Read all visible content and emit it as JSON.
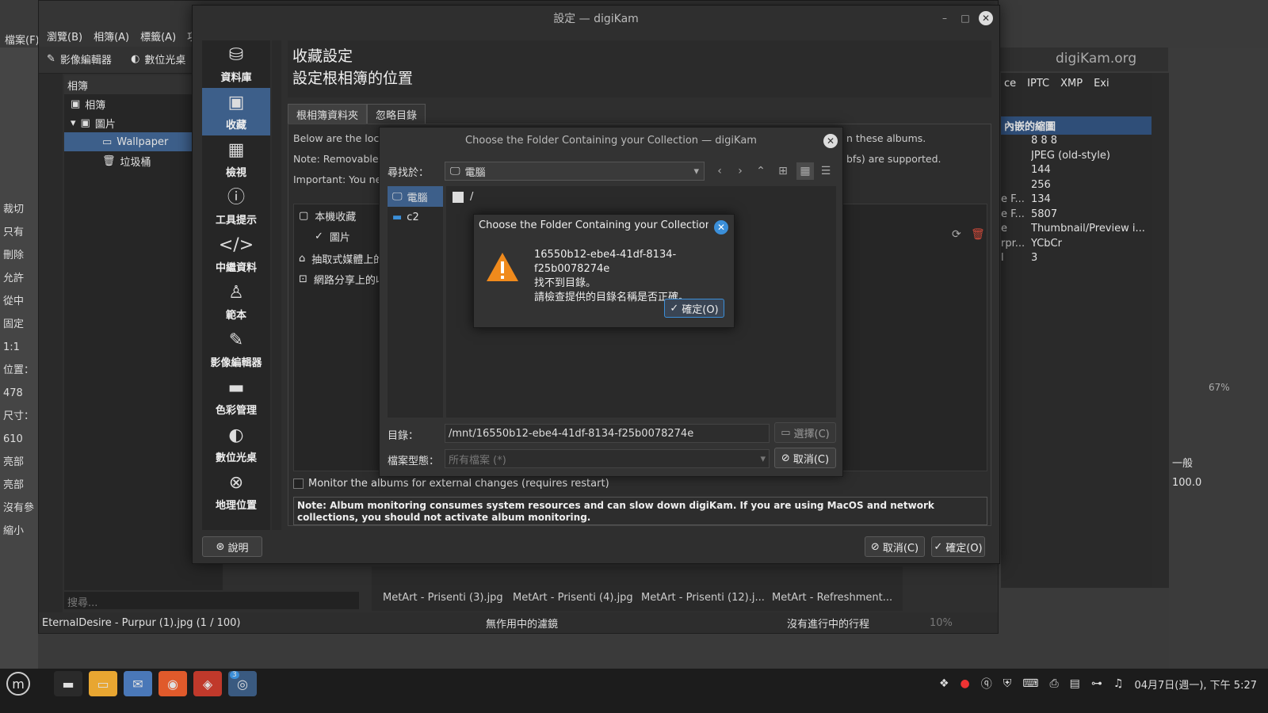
{
  "background": {
    "gimp_left_labels": [
      "檔案(F)",
      "裁切",
      "只有",
      "刪除",
      "允許",
      "從中",
      "固定",
      "1:1",
      "位置：",
      "478",
      "尺寸：",
      "610",
      "亮部",
      "亮部",
      "沒有參",
      "縮小"
    ],
    "digikam_menu": [
      "瀏覽(B)",
      "相簿(A)",
      "標籤(A)",
      "項"
    ],
    "digikam_toolbar": {
      "image_editor": "影像編輯器",
      "light_table": "數位光桌"
    },
    "album_tree": {
      "header": "相簿",
      "root": "相簿",
      "pictures": "圖片",
      "wallpaper": "Wallpaper",
      "trash": "垃圾桶",
      "search_placeholder": "搜尋..."
    },
    "statusbar": {
      "file": "EternalDesire - Purpur (1).jpg  (1 / 100)",
      "filter": "無作用中的濾鏡",
      "process": "沒有進行中的行程",
      "zoom": "10%"
    },
    "thumbnails": [
      "MetArt - Prisenti (3).jpg",
      "MetArt - Prisenti (4).jpg",
      "MetArt - Prisenti (12).j...",
      "MetArt - Refreshment..."
    ],
    "right_panel": {
      "brand": "digiKam.org",
      "tabs": [
        "ce",
        "IPTC",
        "XMP",
        "Exi"
      ],
      "header": "內嵌的縮圖",
      "rows": [
        {
          "key": "",
          "value": "8 8 8"
        },
        {
          "key": "",
          "value": "JPEG (old-style)"
        },
        {
          "key": "",
          "value": "144"
        },
        {
          "key": "",
          "value": "256"
        },
        {
          "key": "e F...",
          "value": "134"
        },
        {
          "key": "e F...",
          "value": "5807"
        },
        {
          "key": "e",
          "value": "Thumbnail/Preview i..."
        },
        {
          "key": "rpr...",
          "value": "YCbCr"
        },
        {
          "key": "l",
          "value": "3"
        }
      ]
    },
    "gimp_right": {
      "zoom": "67%",
      "mode": "一般",
      "opacity": "100.0"
    }
  },
  "settings": {
    "title": "設定 — digiKam",
    "nav": [
      {
        "icon": "database-icon",
        "glyph": "⛁",
        "label": "資料庫"
      },
      {
        "icon": "collection-icon",
        "glyph": "▣",
        "label": "收藏"
      },
      {
        "icon": "grid-view-icon",
        "glyph": "▦",
        "label": "檢視"
      },
      {
        "icon": "info-icon",
        "glyph": "ⓘ",
        "label": "工具提示"
      },
      {
        "icon": "code-icon",
        "glyph": "</>",
        "label": "中繼資料"
      },
      {
        "icon": "person-icon",
        "glyph": "♙",
        "label": "範本"
      },
      {
        "icon": "pencil-icon",
        "glyph": "✎",
        "label": "影像編輯器"
      },
      {
        "icon": "color-icon",
        "glyph": "▬",
        "label": "色彩管理"
      },
      {
        "icon": "light-table-icon",
        "glyph": "◐",
        "label": "數位光桌"
      },
      {
        "icon": "globe-icon",
        "glyph": "⊗",
        "label": "地理位置"
      }
    ],
    "heading_line1": "收藏設定",
    "heading_line2": "設定根相簿的位置",
    "tabs": [
      "根相簿資料夾",
      "忽略目錄"
    ],
    "info_lines": [
      "Below are the locat",
      "Note: Removable m",
      "Important: You nee"
    ],
    "info_tails": [
      "n these albums.",
      "bfs) are supported."
    ],
    "collections": {
      "local": "本機收藏",
      "pictures": "圖片",
      "removable": "抽取式媒體上的",
      "network": "網路分享上的收"
    },
    "monitor_label": "Monitor the albums for external changes (requires restart)",
    "note": "Note: Album monitoring consumes system resources and can slow down digiKam. If you are using MacOS and network collections, you should not activate album monitoring.",
    "help_label": "說明",
    "cancel_label": "取消(C)",
    "ok_label": "確定(O)"
  },
  "chooser": {
    "title": "Choose the Folder Containing your Collection — digiKam",
    "lookin_label": "尋找於：",
    "lookin_value": "電腦",
    "places": [
      "電腦",
      "c2"
    ],
    "root_entry": "/",
    "dir_label": "目錄：",
    "dir_value": "/mnt/16550b12-ebe4-41df-8134-f25b0078274e",
    "choose_label": "選擇(C)",
    "type_label": "檔案型態：",
    "type_value": "所有檔案 (*)",
    "cancel_label": "取消(C)"
  },
  "error": {
    "title": "Choose the Folder Containing your Collection ...",
    "line1": "16550b12-ebe4-41df-8134-f25b0078274e",
    "line2": "找不到目錄。",
    "line3": "請檢查提供的目錄名稱是否正確。",
    "ok_label": "確定(O)"
  },
  "taskbar": {
    "clock": "04月7日(週一), 下午 5:27",
    "badge": "3"
  }
}
